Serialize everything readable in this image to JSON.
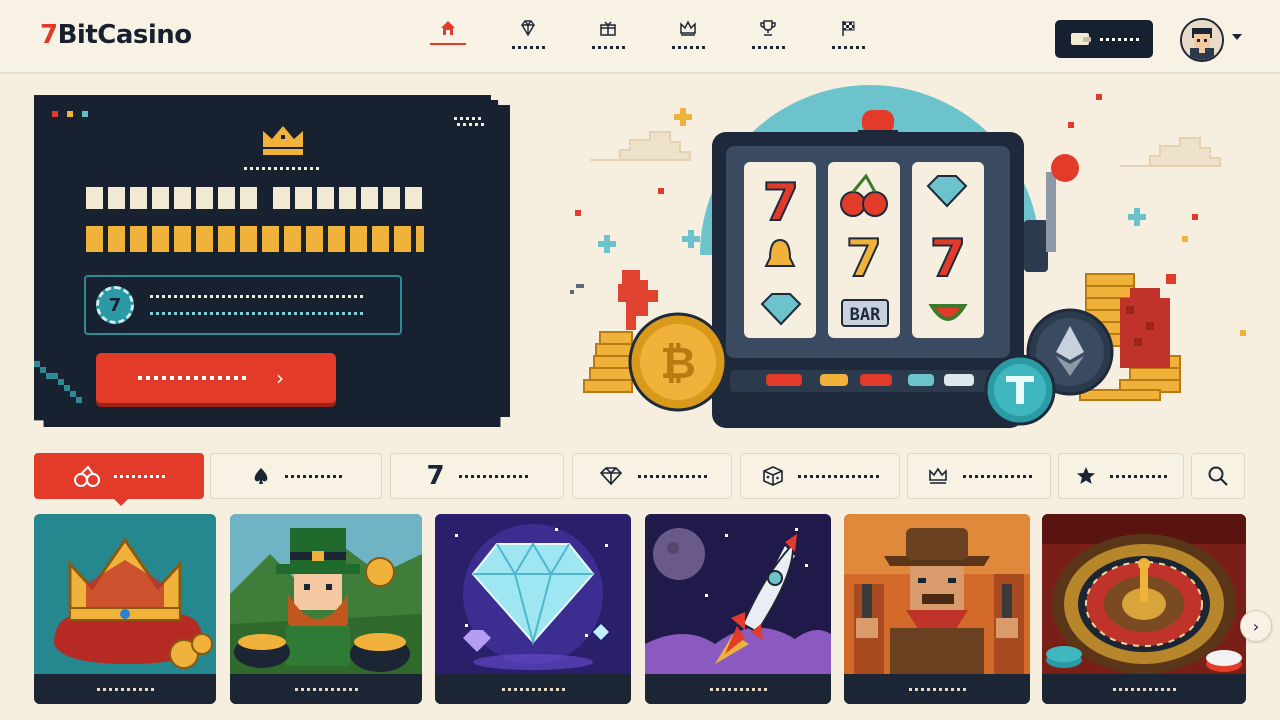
{
  "brand": {
    "prefix": "7",
    "name": "BitCasino"
  },
  "nav": [
    {
      "icon": "home-icon",
      "active": true
    },
    {
      "icon": "diamond-icon",
      "active": false
    },
    {
      "icon": "gift-icon",
      "active": false
    },
    {
      "icon": "crown-icon",
      "active": false
    },
    {
      "icon": "trophy-icon",
      "active": false
    },
    {
      "icon": "checkered-flag-icon",
      "active": false
    }
  ],
  "wallet": {
    "icon": "wallet-icon"
  },
  "promo": {
    "chip_label": "7",
    "cta_arrow": "›"
  },
  "hero": {
    "reel_bar_label": "BAR"
  },
  "categories": [
    {
      "icon": "cherries-icon",
      "active": true
    },
    {
      "icon": "spade-icon",
      "active": false
    },
    {
      "icon": "seven-icon",
      "glyph": "7",
      "active": false
    },
    {
      "icon": "diamond-icon",
      "active": false
    },
    {
      "icon": "dice-icon",
      "active": false
    },
    {
      "icon": "crown-icon",
      "active": false
    },
    {
      "icon": "star-icon",
      "active": false
    },
    {
      "icon": "search-icon",
      "active": false
    }
  ],
  "games": [
    {
      "theme": "royal-crown"
    },
    {
      "theme": "leprechaun-gold"
    },
    {
      "theme": "diamond"
    },
    {
      "theme": "rocket"
    },
    {
      "theme": "cowboy"
    },
    {
      "theme": "roulette"
    }
  ],
  "carousel": {
    "next": "›"
  },
  "colors": {
    "accent": "#e23b2a",
    "navy": "#17212f",
    "cream": "#f6efe0",
    "gold": "#f0b23a",
    "teal": "#2e8b95"
  }
}
